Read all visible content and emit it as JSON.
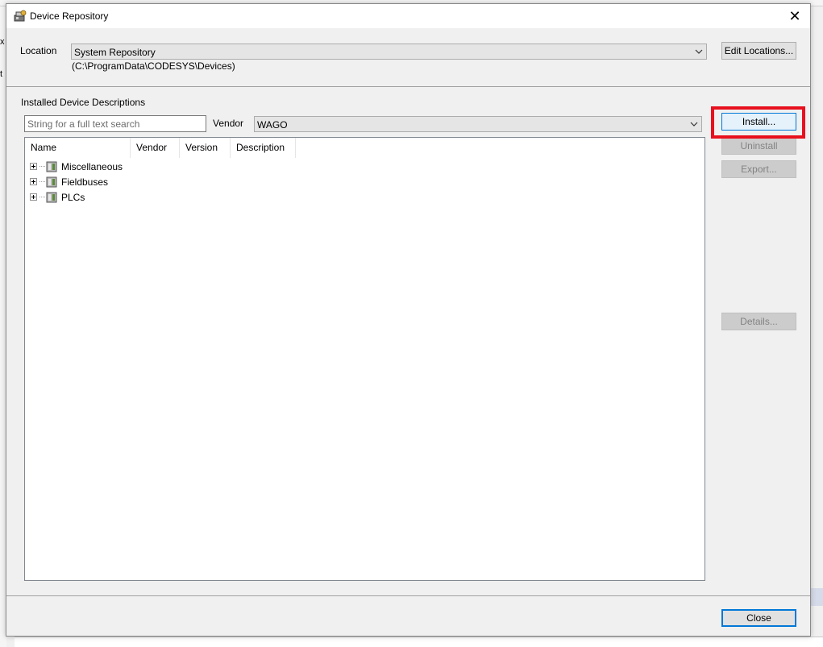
{
  "background": {
    "left_marks": [
      "x",
      "t"
    ]
  },
  "dialog": {
    "title": "Device Repository",
    "close_glyph": "✕"
  },
  "location": {
    "label": "Location",
    "selected": "System Repository",
    "path": "(C:\\ProgramData\\CODESYS\\Devices)",
    "edit_button": "Edit Locations..."
  },
  "installed": {
    "heading": "Installed Device Descriptions",
    "search_placeholder": "String for a full text search",
    "search_value": "",
    "vendor_label": "Vendor",
    "vendor_selected": "WAGO"
  },
  "tree": {
    "columns": [
      "Name",
      "Vendor",
      "Version",
      "Description"
    ],
    "rows": [
      {
        "label": "Miscellaneous"
      },
      {
        "label": "Fieldbuses"
      },
      {
        "label": "PLCs"
      }
    ]
  },
  "buttons": {
    "install": "Install...",
    "uninstall": "Uninstall",
    "export": "Export...",
    "details": "Details...",
    "close": "Close"
  },
  "colors": {
    "highlight": "#e8101e",
    "focus_blue": "#0078d7"
  },
  "icons": {
    "title": "device-repository-icon",
    "dropdown": "chevron-down-icon",
    "tree_node": "device-folder-icon",
    "expander": "plus-expander-icon"
  }
}
